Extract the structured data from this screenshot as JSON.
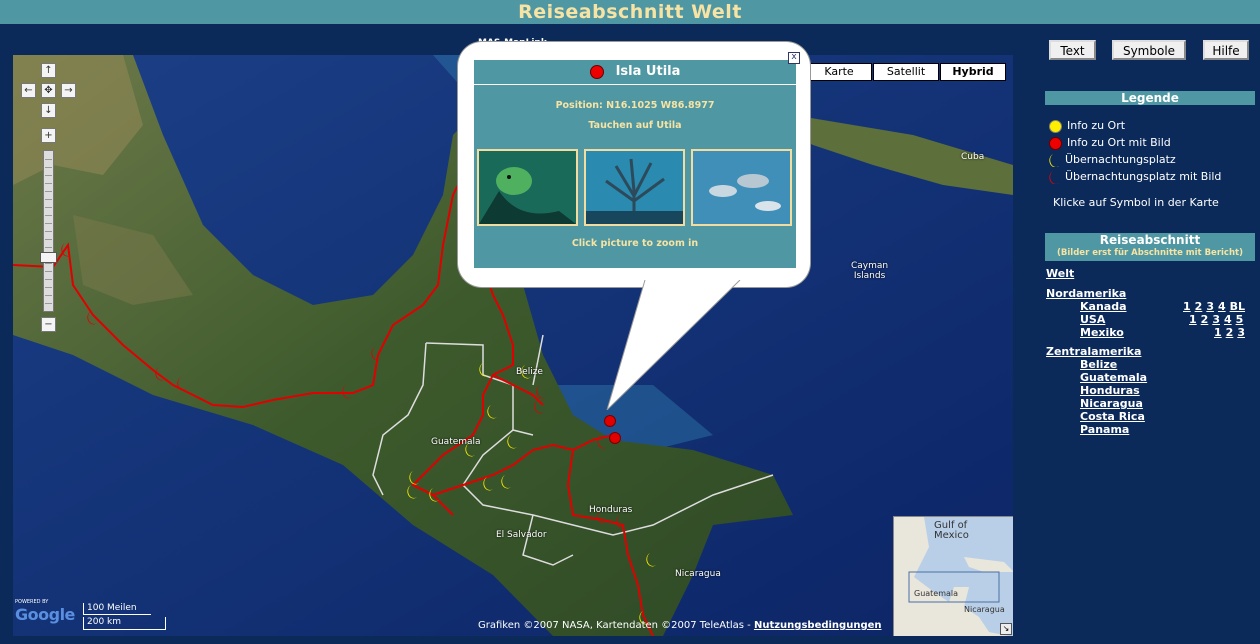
{
  "title": "Reiseabschnitt Welt",
  "maplink": "MAS-MapLink",
  "top_buttons": {
    "text": "Text",
    "symbols": "Symbole",
    "help": "Hilfe"
  },
  "map_types": {
    "map": "Karte",
    "satellite": "Satellit",
    "hybrid": "Hybrid",
    "active": "Hybrid"
  },
  "info_window": {
    "title": "Isla Utila",
    "position": "Position: N16.1025 W86.8977",
    "subtitle": "Tauchen auf Utila",
    "zoom_hint": "Click picture to zoom in",
    "close": "x"
  },
  "map_labels": {
    "cuba": "Cuba",
    "cayman": "Cayman\nIslands",
    "belize": "Belize",
    "guatemala": "Guatemala",
    "el_salvador": "El Salvador",
    "honduras": "Honduras",
    "nicaragua": "Nicaragua",
    "minimap_gulf": "Gulf of\nMexico",
    "minimap_guatemala": "Guatemala",
    "minimap_nicaragua": "Nicaragua"
  },
  "scale": {
    "miles": "100 Meilen",
    "km": "200 km"
  },
  "google": {
    "powered": "POWERED BY",
    "brand": "Google"
  },
  "copyright": {
    "text": "Grafiken ©2007 NASA, Kartendaten ©2007 TeleAtlas - ",
    "terms": "Nutzungsbedingungen"
  },
  "legend": {
    "title": "Legende",
    "items": [
      {
        "label": "Info zu Ort",
        "color": "#ffee00"
      },
      {
        "label": "Info zu Ort mit Bild",
        "color": "#ee0000"
      },
      {
        "label": "Übernachtungsplatz",
        "color": "#ffee00"
      },
      {
        "label": "Übernachtungsplatz mit Bild",
        "color": "#ee0000"
      }
    ],
    "hint": "Klicke auf Symbol in der Karte"
  },
  "sections": {
    "title": "Reiseabschnitt",
    "subtitle": "(Bilder erst für Abschnitte mit Bericht)",
    "world": "Welt",
    "north_america": "Nordamerika",
    "canada": "Kanada",
    "canada_pages": [
      "1",
      "2",
      "3",
      "4",
      "BL"
    ],
    "usa": "USA",
    "usa_pages": [
      "1",
      "2",
      "3",
      "4",
      "5"
    ],
    "mexico": "Mexiko",
    "mexico_pages": [
      "1",
      "2",
      "3"
    ],
    "central_america": "Zentralamerika",
    "belize": "Belize",
    "guatemala": "Guatemala",
    "honduras": "Honduras",
    "nicaragua": "Nicaragua",
    "costa_rica": "Costa Rica",
    "panama": "Panama"
  },
  "colors": {
    "title_bg": "#4f97a3",
    "title_text": "#f7e3a3",
    "page_bg": "#0b2a5a",
    "route": "#e00000"
  }
}
